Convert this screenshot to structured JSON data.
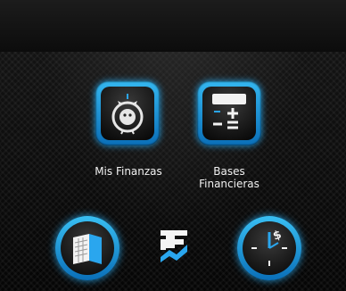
{
  "home": {
    "tiles": [
      {
        "label": "Mis Finanzas",
        "icon": "piggy-bank-icon"
      },
      {
        "label": "Bases\nFinancieras",
        "icon": "calculator-icon"
      }
    ],
    "bottom_bar": {
      "left_button_icon": "book-icon",
      "center_logo": "app-logo-icon",
      "right_button_icon": "dollar-clock-icon"
    }
  },
  "colors": {
    "accent": "#1f9ee6",
    "background": "#0b0b0b",
    "label": "#f2f2f2"
  }
}
